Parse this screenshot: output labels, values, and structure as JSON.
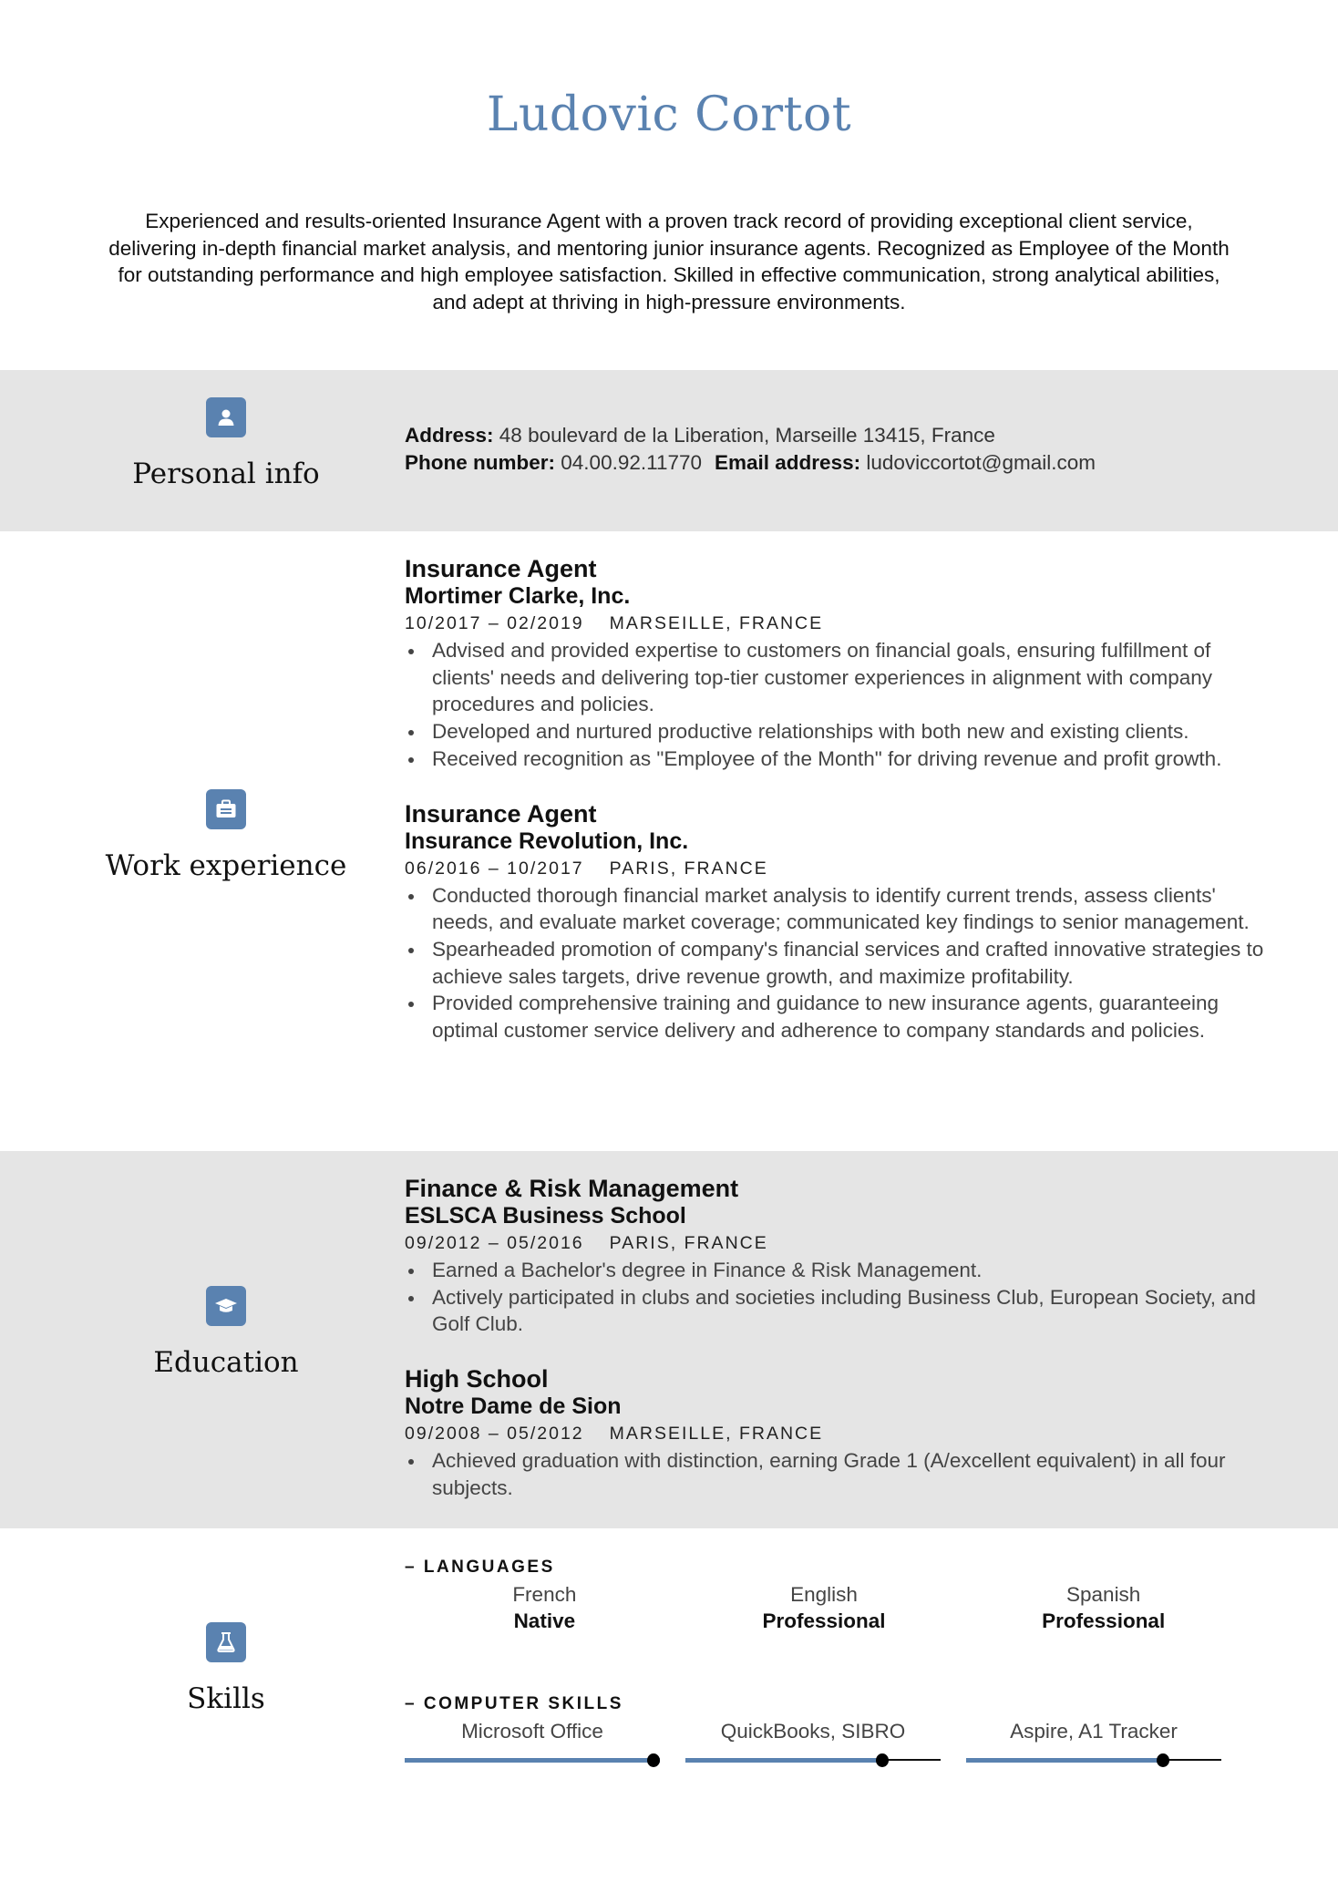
{
  "header": {
    "name": "Ludovic Cortot",
    "summary": "Experienced and results-oriented Insurance Agent with a proven track record of providing exceptional client service, delivering in-depth financial market analysis, and mentoring junior insurance agents. Recognized as Employee of the Month for outstanding performance and high employee satisfaction. Skilled in effective communication, strong analytical abilities, and adept at thriving in high-pressure environments."
  },
  "colors": {
    "accent": "#5a82b0",
    "band_gray": "#e5e5e5",
    "text": "#111111",
    "muted_text": "#444444"
  },
  "personal_info": {
    "section_label": "Personal info",
    "icon": "user-icon",
    "address_label": "Address:",
    "address_value": "48 boulevard de la Liberation, Marseille 13415, France",
    "phone_label": "Phone number:",
    "phone_value": "04.00.92.11770",
    "email_label": "Email address:",
    "email_value": "ludoviccortot@gmail.com"
  },
  "work_experience": {
    "section_label": "Work experience",
    "icon": "briefcase-icon",
    "entries": [
      {
        "title": "Insurance Agent",
        "organization": "Mortimer Clarke, Inc.",
        "dates": "10/2017 – 02/2019",
        "location": "MARSEILLE, FRANCE",
        "bullets": [
          "Advised and provided expertise to customers on financial goals, ensuring fulfillment of clients' needs and delivering top-tier customer experiences in alignment with company procedures and policies.",
          "Developed and nurtured productive relationships with both new and existing clients.",
          "Received recognition as \"Employee of the Month\" for driving revenue and profit growth."
        ]
      },
      {
        "title": "Insurance Agent",
        "organization": "Insurance Revolution, Inc.",
        "dates": "06/2016 – 10/2017",
        "location": "PARIS, FRANCE",
        "bullets": [
          "Conducted thorough financial market analysis to identify current trends, assess clients' needs, and evaluate market coverage; communicated key findings to senior management.",
          "Spearheaded promotion of company's financial services and crafted innovative strategies to achieve sales targets, drive revenue growth, and maximize profitability.",
          "Provided comprehensive training and guidance to new insurance agents, guaranteeing optimal customer service delivery and adherence to company standards and policies."
        ]
      }
    ]
  },
  "education": {
    "section_label": "Education",
    "icon": "graduation-cap-icon",
    "entries": [
      {
        "title": "Finance & Risk Management",
        "organization": "ESLSCA Business School",
        "dates": "09/2012 – 05/2016",
        "location": "PARIS, FRANCE",
        "bullets": [
          "Earned a Bachelor's degree in Finance & Risk Management.",
          "Actively participated in clubs and societies including Business Club, European Society, and Golf Club."
        ]
      },
      {
        "title": "High School",
        "organization": "Notre Dame de Sion",
        "dates": "09/2008 – 05/2012",
        "location": "MARSEILLE, FRANCE",
        "bullets": [
          "Achieved graduation with distinction, earning Grade 1 (A/excellent equivalent) in all four subjects."
        ]
      }
    ]
  },
  "skills": {
    "section_label": "Skills",
    "icon": "flask-icon",
    "languages_heading": "– LANGUAGES",
    "languages": [
      {
        "name": "French",
        "level": "Native"
      },
      {
        "name": "English",
        "level": "Professional"
      },
      {
        "name": "Spanish",
        "level": "Professional"
      }
    ],
    "computer_heading": "– COMPUTER SKILLS",
    "computer_skills": [
      {
        "name": "Microsoft Office",
        "proficiency": 1.0
      },
      {
        "name": "QuickBooks, SIBRO",
        "proficiency": 0.77
      },
      {
        "name": "Aspire, A1 Tracker",
        "proficiency": 0.77
      }
    ]
  }
}
